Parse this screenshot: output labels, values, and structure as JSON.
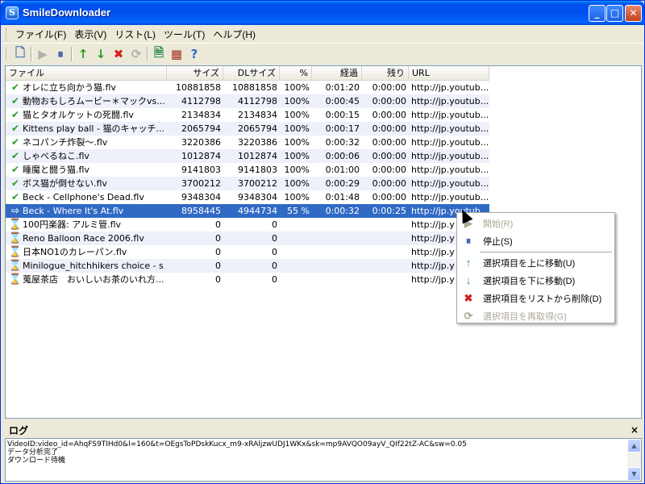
{
  "window": {
    "title": "SmileDownloader",
    "app_icon_letter": "S",
    "controls": {
      "minimize": "_",
      "maximize": "□",
      "close": "✕"
    }
  },
  "menubar": [
    "ファイル(F)",
    "表示(V)",
    "リスト(L)",
    "ツール(T)",
    "ヘルプ(H)"
  ],
  "toolbar": {
    "icons": [
      {
        "name": "new-document-icon",
        "glyph": "🗋",
        "disabled": false,
        "color": "#3a6ab8"
      },
      {
        "name": "start-icon",
        "glyph": "▶",
        "disabled": true,
        "color": "#b0b0b0"
      },
      {
        "name": "stop-icon",
        "glyph": "⏸",
        "disabled": false,
        "color": "#3a5fb0"
      },
      {
        "name": "move-up-icon",
        "glyph": "↑",
        "disabled": false,
        "color": "#2a9d2a"
      },
      {
        "name": "move-down-icon",
        "glyph": "↓",
        "disabled": false,
        "color": "#2a9d2a"
      },
      {
        "name": "delete-icon",
        "glyph": "✖",
        "disabled": false,
        "color": "#d42020"
      },
      {
        "name": "refetch-icon",
        "glyph": "⟳",
        "disabled": true,
        "color": "#b0b0b0"
      },
      {
        "name": "export-icon",
        "glyph": "🗎",
        "disabled": false,
        "color": "#2a8a4a"
      },
      {
        "name": "settings-icon",
        "glyph": "▦",
        "disabled": false,
        "color": "#a03020"
      },
      {
        "name": "help-icon",
        "glyph": "?",
        "disabled": false,
        "color": "#2a6ad0"
      }
    ]
  },
  "table": {
    "columns": [
      {
        "label": "ファイル",
        "width": 200,
        "align": "left"
      },
      {
        "label": "サイズ",
        "width": 70,
        "align": "right"
      },
      {
        "label": "DLサイズ",
        "width": 70,
        "align": "right"
      },
      {
        "label": "%",
        "width": 40,
        "align": "right"
      },
      {
        "label": "経過",
        "width": 62,
        "align": "right"
      },
      {
        "label": "残り",
        "width": 58,
        "align": "right"
      },
      {
        "label": "URL",
        "width": 100,
        "align": "left"
      }
    ],
    "rows": [
      {
        "status": "done",
        "name": "オレに立ち向かう猫.flv",
        "size": "10881858",
        "dl": "10881858",
        "pct": "100%",
        "elapsed": "0:01:20",
        "remaining": "0:00:00",
        "url": "http://jp.youtub..."
      },
      {
        "status": "done",
        "name": "動物おもしろムービー＊マックvs...",
        "size": "4112798",
        "dl": "4112798",
        "pct": "100%",
        "elapsed": "0:00:45",
        "remaining": "0:00:00",
        "url": "http://jp.youtub..."
      },
      {
        "status": "done",
        "name": "猫とタオルケットの死闘.flv",
        "size": "2134834",
        "dl": "2134834",
        "pct": "100%",
        "elapsed": "0:00:15",
        "remaining": "0:00:00",
        "url": "http://jp.youtub..."
      },
      {
        "status": "done",
        "name": "Kittens play ball - 猫のキャッチ...",
        "size": "2065794",
        "dl": "2065794",
        "pct": "100%",
        "elapsed": "0:00:17",
        "remaining": "0:00:00",
        "url": "http://jp.youtub..."
      },
      {
        "status": "done",
        "name": "ネコパンチ炸裂～.flv",
        "size": "3220386",
        "dl": "3220386",
        "pct": "100%",
        "elapsed": "0:00:32",
        "remaining": "0:00:00",
        "url": "http://jp.youtub..."
      },
      {
        "status": "done",
        "name": "しゃべるねこ.flv",
        "size": "1012874",
        "dl": "1012874",
        "pct": "100%",
        "elapsed": "0:00:06",
        "remaining": "0:00:00",
        "url": "http://jp.youtub..."
      },
      {
        "status": "done",
        "name": "睡魔と闘う猫.flv",
        "size": "9141803",
        "dl": "9141803",
        "pct": "100%",
        "elapsed": "0:01:00",
        "remaining": "0:00:00",
        "url": "http://jp.youtub..."
      },
      {
        "status": "done",
        "name": "ボス猫が倒せない.flv",
        "size": "3700212",
        "dl": "3700212",
        "pct": "100%",
        "elapsed": "0:00:29",
        "remaining": "0:00:00",
        "url": "http://jp.youtub..."
      },
      {
        "status": "done",
        "name": "Beck - Cellphone's Dead.flv",
        "size": "9348304",
        "dl": "9348304",
        "pct": "100%",
        "elapsed": "0:01:48",
        "remaining": "0:00:00",
        "url": "http://jp.youtub..."
      },
      {
        "status": "downloading",
        "name": "Beck - Where It's At.flv",
        "size": "8958445",
        "dl": "4944734",
        "pct": "55 %",
        "elapsed": "0:00:32",
        "remaining": "0:00:25",
        "url": "http://jp.youtub..."
      },
      {
        "status": "waiting",
        "name": "100円楽器: アルミ管.flv",
        "size": "0",
        "dl": "0",
        "pct": "",
        "elapsed": "",
        "remaining": "",
        "url": "http://jp.y"
      },
      {
        "status": "waiting",
        "name": "Reno Balloon Race 2006.flv",
        "size": "0",
        "dl": "0",
        "pct": "",
        "elapsed": "",
        "remaining": "",
        "url": "http://jp.y"
      },
      {
        "status": "waiting",
        "name": "日本NO1のカレーパン.flv",
        "size": "0",
        "dl": "0",
        "pct": "",
        "elapsed": "",
        "remaining": "",
        "url": "http://jp.y"
      },
      {
        "status": "waiting",
        "name": "Minilogue_hitchhikers choice - s...",
        "size": "0",
        "dl": "0",
        "pct": "",
        "elapsed": "",
        "remaining": "",
        "url": "http://jp.y"
      },
      {
        "status": "waiting",
        "name": "蒐屋茶店　おいしいお茶のいれ方...",
        "size": "0",
        "dl": "0",
        "pct": "",
        "elapsed": "",
        "remaining": "",
        "url": "http://jp.y"
      }
    ],
    "status_icons": {
      "done": "✔",
      "downloading": "⇨",
      "waiting": "⌛"
    }
  },
  "context_menu": {
    "items": [
      {
        "name": "ctx-start",
        "label": "開始(R)",
        "icon": "▶",
        "icon_name": "play-icon",
        "disabled": true,
        "color": "#aca899"
      },
      {
        "name": "ctx-stop",
        "label": "停止(S)",
        "icon": "⏸",
        "icon_name": "pause-icon",
        "disabled": false,
        "color": "#3a5fb0"
      },
      {
        "sep": true
      },
      {
        "name": "ctx-move-up",
        "label": "選択項目を上に移動(U)",
        "icon": "↑",
        "icon_name": "arrow-up-icon",
        "disabled": false,
        "color": "#2a9d2a"
      },
      {
        "name": "ctx-move-down",
        "label": "選択項目を下に移動(D)",
        "icon": "↓",
        "icon_name": "arrow-down-icon",
        "disabled": false,
        "color": "#2a9d2a"
      },
      {
        "name": "ctx-delete",
        "label": "選択項目をリストから削除(D)",
        "icon": "✖",
        "icon_name": "delete-icon",
        "disabled": false,
        "color": "#d42020"
      },
      {
        "name": "ctx-refetch",
        "label": "選択項目を再取得(G)",
        "icon": "⟳",
        "icon_name": "refetch-icon",
        "disabled": true,
        "color": "#aca899"
      }
    ]
  },
  "log": {
    "title": "ログ",
    "close": "×",
    "lines": [
      "VideoID:video_id=AhqFS9TIHd0&l=160&t=OEgsToPDskKucx_m9-xRAljzwUDJ1WKx&sk=mp9AVQO09ayV_QIf22tZ-AC&sw=0.05",
      "データ分析完了",
      "ダウンロード待機"
    ],
    "scroll_up": "▲",
    "scroll_down": "▼"
  }
}
